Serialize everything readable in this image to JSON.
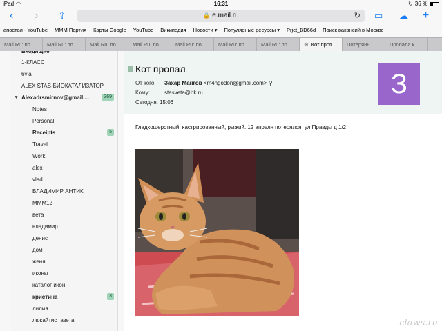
{
  "status": {
    "device": "iPad",
    "time": "16:31",
    "battery": "36 %"
  },
  "browser": {
    "url": "e.mail.ru"
  },
  "bookmarks": [
    "апостол - YouTube",
    "МММ Партия",
    "Карты Google",
    "YouTube",
    "Википедия",
    "Новости ▾",
    "Популярные ресурсы ▾",
    "Prjct_BD66d",
    "Поиск вакансий в Москве"
  ],
  "tabs": [
    "Mail.Ru: по...",
    "Mail.Ru: по...",
    "Mail.Ru: по...",
    "Mail.Ru: по...",
    "Mail.Ru: по...",
    "Mail.Ru: по...",
    "Mail.Ru: по...",
    "Кот проп...",
    "Потерянн...",
    "Пропала к..."
  ],
  "sidebar": {
    "items": [
      {
        "label": "Входящие",
        "count": ""
      },
      {
        "label": "1-КЛАСС",
        "count": ""
      },
      {
        "label": "6via",
        "count": ""
      },
      {
        "label": "ALEX STAS-БИОКАТАЛИЗАТОР",
        "count": ""
      },
      {
        "label": "Alexadrsmirnov@gmail....",
        "count": "369"
      },
      {
        "label": "Notes",
        "count": ""
      },
      {
        "label": "Personal",
        "count": ""
      },
      {
        "label": "Receipts",
        "count": "5"
      },
      {
        "label": "Travel",
        "count": ""
      },
      {
        "label": "Work",
        "count": ""
      },
      {
        "label": "alex",
        "count": ""
      },
      {
        "label": "vlad",
        "count": ""
      },
      {
        "label": "ВЛАДИМИР АНТИК",
        "count": ""
      },
      {
        "label": "МММ12",
        "count": ""
      },
      {
        "label": "вета",
        "count": ""
      },
      {
        "label": "владимир",
        "count": ""
      },
      {
        "label": "денис",
        "count": ""
      },
      {
        "label": "дом",
        "count": ""
      },
      {
        "label": "женя",
        "count": ""
      },
      {
        "label": "иконы",
        "count": ""
      },
      {
        "label": "каталог икон",
        "count": ""
      },
      {
        "label": "кристина",
        "count": "3"
      },
      {
        "label": "лилия",
        "count": ""
      },
      {
        "label": "люкайтис газета",
        "count": ""
      }
    ]
  },
  "email": {
    "subject": "Кот пропал",
    "from_label": "От кого:",
    "from_name": "Захар Мангов",
    "from_email": "<m4ngodon@gmail.com>",
    "to_label": "Кому:",
    "to": "stasveta@bk.ru",
    "date": "Сегодня, 15:06",
    "avatar_letter": "З",
    "avatar_color": "#9966cc",
    "body": "Гладкошерстный, кастрированный, рыжий. 12 апреля потерялся. ул Правды д 1/2"
  },
  "watermark": "claws.ru"
}
